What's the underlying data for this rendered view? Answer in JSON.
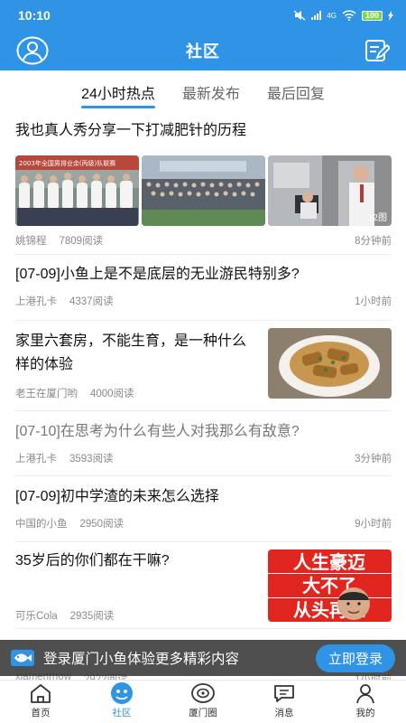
{
  "status_bar": {
    "time": "10:10",
    "battery": "100",
    "network": "4G"
  },
  "header": {
    "title": "社区"
  },
  "tabs": [
    {
      "label": "24小时热点",
      "active": true
    },
    {
      "label": "最新发布",
      "active": false
    },
    {
      "label": "最后回复",
      "active": false
    }
  ],
  "posts": [
    {
      "title": "我也真人秀分享一下打减肥针的历程",
      "author": "姚锦程",
      "reads": "7809阅读",
      "time": "8分钟前",
      "image_count": "12图"
    },
    {
      "title": "[07-09]小鱼上是不是底层的无业游民特别多?",
      "author": "上港孔卡",
      "reads": "4337阅读",
      "time": "1小时前"
    },
    {
      "title": "家里六套房，不能生育，是一种什么样的体验",
      "author": "老王在厦门哟",
      "reads": "4000阅读",
      "time": ""
    },
    {
      "title": "[07-10]在思考为什么有些人对我那么有敌意?",
      "author": "上港孔卡",
      "reads": "3593阅读",
      "time": "3分钟前"
    },
    {
      "title": "[07-09]初中学渣的未来怎么选择",
      "author": "中国的小鱼",
      "reads": "2950阅读",
      "time": "9小时前"
    },
    {
      "title": "35岁后的你们都在干嘛?",
      "author": "可乐Cola",
      "reads": "2935阅读",
      "time": ""
    }
  ],
  "photo_captions": [
    "2003年全国男排业余(丙级)队联赛"
  ],
  "poster_text": [
    "人生豪迈",
    "大不了",
    "从头再来"
  ],
  "peek_row": {
    "author": "xiamenrnow",
    "reads": "2922阅读",
    "time": "1小时前"
  },
  "login_banner": {
    "text": "登录厦门小鱼体验更多精彩内容",
    "button": "立即登录"
  },
  "bottom_nav": [
    {
      "label": "首页",
      "active": false
    },
    {
      "label": "社区",
      "active": true
    },
    {
      "label": "厦门圈",
      "active": false
    },
    {
      "label": "消息",
      "active": false
    },
    {
      "label": "我的",
      "active": false
    }
  ],
  "colors": {
    "brand": "#2f93e6",
    "text": "#111111",
    "meta": "#8a8a8a"
  }
}
